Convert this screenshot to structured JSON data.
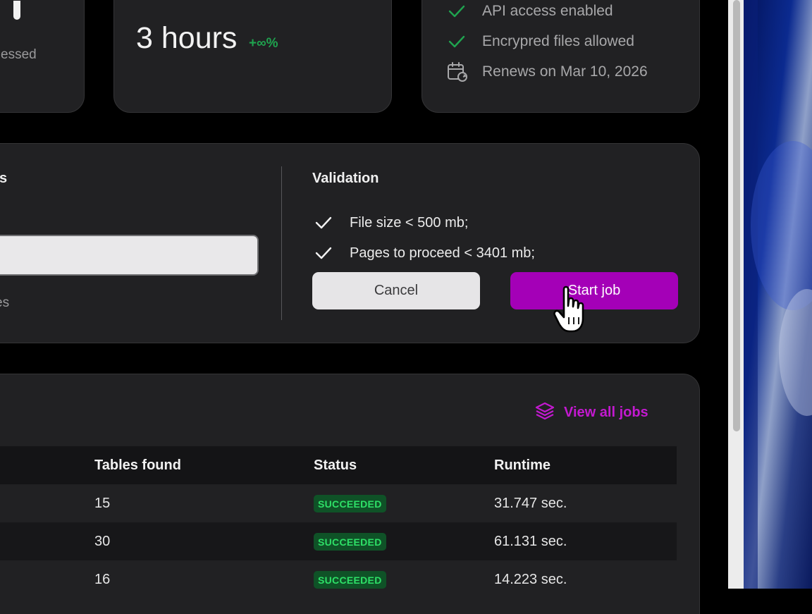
{
  "cards": {
    "processed": {
      "glyph": "1",
      "label": "essed"
    },
    "hours": {
      "value": "3 hours",
      "growth": "+∞%"
    },
    "plan": {
      "features": [
        {
          "label": "API access enabled",
          "icon": "check-icon"
        },
        {
          "label": "Encrypred files allowed",
          "icon": "check-icon"
        },
        {
          "label": "Renews on Mar 10, 2026",
          "icon": "calendar-refresh-icon"
        }
      ]
    }
  },
  "upload": {
    "title_fragment": "s",
    "hint_fragment": "es",
    "input_value": ""
  },
  "validation": {
    "title": "Validation",
    "items": [
      "File size < 500 mb;",
      "Pages to proceed < 3401 mb;"
    ],
    "cancel_label": "Cancel",
    "start_label": "Start job"
  },
  "jobs": {
    "view_all_label": "View all jobs",
    "columns": [
      "Tables found",
      "Status",
      "Runtime"
    ],
    "rows": [
      {
        "tables": "15",
        "status": "SUCCEEDED",
        "runtime": "31.747 sec."
      },
      {
        "tables": "30",
        "status": "SUCCEEDED",
        "runtime": "61.131 sec."
      },
      {
        "tables": "16",
        "status": "SUCCEEDED",
        "runtime": "14.223 sec."
      }
    ]
  },
  "colors": {
    "accent": "#a400b7",
    "link": "#c319d0",
    "success": "#2ee067",
    "check": "#1fa44f"
  }
}
